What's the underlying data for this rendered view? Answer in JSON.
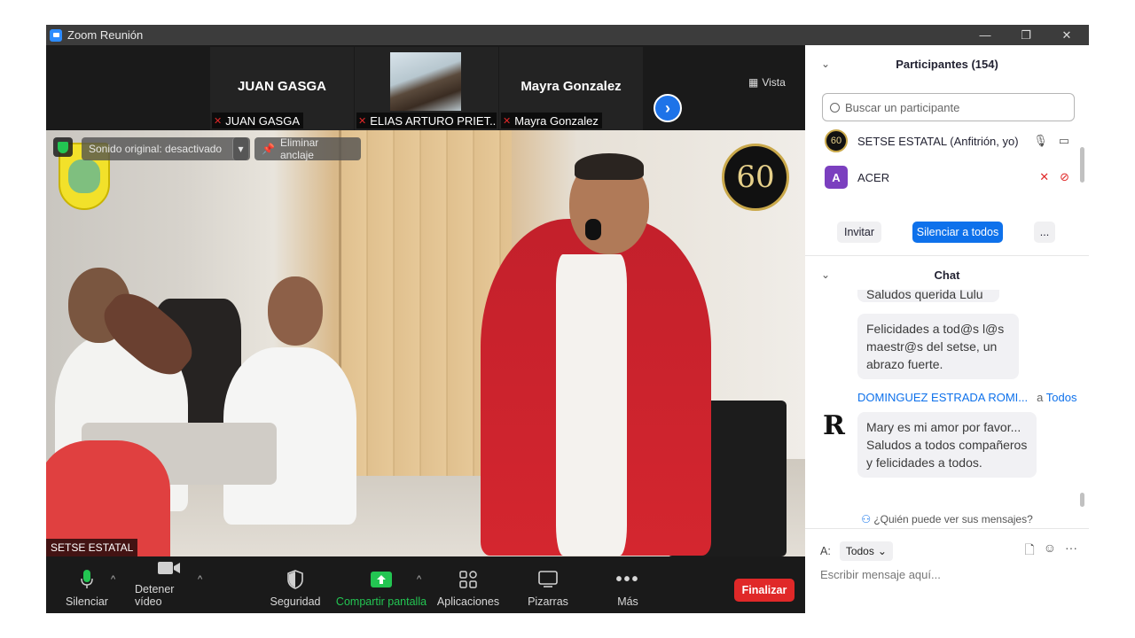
{
  "window": {
    "title": "Zoom Reunión",
    "controls": [
      "—",
      "❐",
      "✕"
    ]
  },
  "thumbnails": [
    {
      "name": "JUAN GASGA",
      "label": "JUAN GASGA",
      "has_video": false
    },
    {
      "name": "",
      "label": "ELIAS ARTURO PRIET...",
      "has_video": true
    },
    {
      "name": "Mayra Gonzalez",
      "label": "Mayra Gonzalez",
      "has_video": false
    }
  ],
  "view_button": "Vista",
  "video": {
    "sound_original": "Sonido original: desactivado",
    "unpin": "Eliminar anclaje",
    "speaker_label": "SETSE ESTATAL",
    "logo_right_text": "60"
  },
  "toolbar": {
    "mute": "Silenciar",
    "stop_video": "Detener vídeo",
    "security": "Seguridad",
    "share": "Compartir pantalla",
    "apps": "Aplicaciones",
    "whiteboards": "Pizarras",
    "more": "Más",
    "end": "Finalizar"
  },
  "participants": {
    "header": "Participantes (154)",
    "search_placeholder": "Buscar un participante",
    "list": [
      {
        "name": "SETSE ESTATAL (Anfitrión, yo)",
        "avatar": "60",
        "muted": false,
        "video_off": false
      },
      {
        "name": "ACER",
        "avatar": "A",
        "muted": true,
        "video_off": true
      }
    ],
    "invite": "Invitar",
    "mute_all": "Silenciar a todos",
    "more": "..."
  },
  "chat": {
    "header": "Chat",
    "partial_message": "Saludos querida Lulu",
    "messages": [
      {
        "text": "Felicidades a tod@s l@s maestr@s del setse, un abrazo fuerte."
      },
      {
        "sender": "DOMINGUEZ ESTRADA ROMI...",
        "to_prefix": "a",
        "to": "Todos",
        "avatar": "R",
        "text": "Mary es mi amor por favor... Saludos a todos compañeros y felicidades a todos."
      }
    ],
    "who_can_see": "¿Quién puede ver sus mensajes?",
    "to_label": "A:",
    "recipient": "Todos",
    "compose_placeholder": "Escribir mensaje aquí..."
  },
  "colors": {
    "accent": "#0e71eb",
    "end_red": "#e02828",
    "share_green": "#23c552",
    "next_blue": "#1e73e8"
  }
}
